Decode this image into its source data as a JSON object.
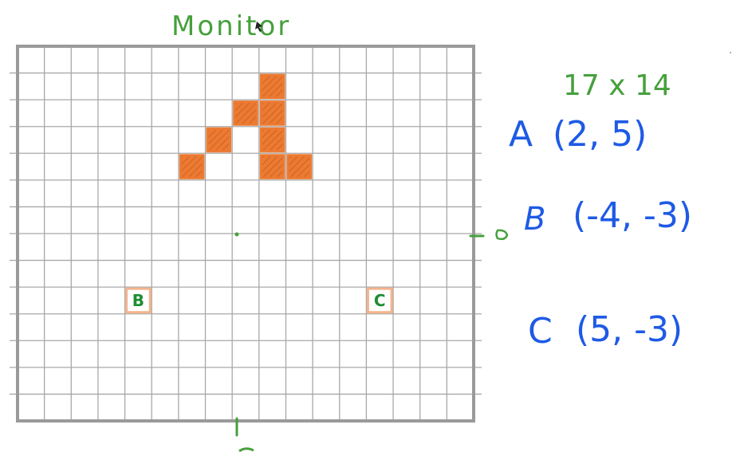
{
  "title": "Monitor",
  "grid_size_label": "17 x 14",
  "grid": {
    "columns": 17,
    "rows": 14,
    "origin_col": 8,
    "origin_row": 7
  },
  "pixels": [
    {
      "x": 1,
      "y": 5
    },
    {
      "x": 1,
      "y": 4
    },
    {
      "x": 0,
      "y": 4
    },
    {
      "x": 1,
      "y": 3
    },
    {
      "x": -1,
      "y": 3
    },
    {
      "x": -2,
      "y": 2
    },
    {
      "x": 2,
      "y": 2
    },
    {
      "x": 1,
      "y": 2
    }
  ],
  "points": [
    {
      "label": "A",
      "coords": "(2, 5)",
      "x": 2,
      "y": 5,
      "marked": false
    },
    {
      "label": "B",
      "coords": "(-4, -3)",
      "x": -4,
      "y": -3,
      "marked": true
    },
    {
      "label": "C",
      "coords": "(5, -3)",
      "x": 5,
      "y": -3,
      "marked": true
    }
  ],
  "colors": {
    "grid": "#a8a8a8",
    "border": "#9a9a9a",
    "pixel_fill": "#ec7a32",
    "pixel_hatch": "#c45a18",
    "marker_outline": "#f4b48c",
    "green": "#46a03c",
    "blue": "#1e5ae6",
    "marker_letter": "#1e8c32"
  }
}
